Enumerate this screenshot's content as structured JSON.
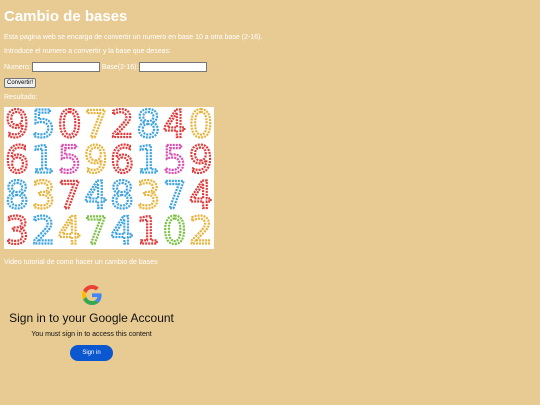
{
  "page": {
    "title": "Cambio de bases",
    "description": "Esta pagina web se encarga de convertir un numero en base 10 a otra base (2-16).",
    "instructions": "Introduce el numero a convertir y la base que deseas:",
    "result_label": "Resultado:",
    "video_caption": "Video tutorial de como hacer un cambio de bases"
  },
  "form": {
    "number_label": "Numero:",
    "number_value": "",
    "base_label": "Base(2-16):",
    "base_value": "",
    "convert_label": "Convertir!"
  },
  "image": {
    "glyphs": [
      {
        "t": "9",
        "c": "#e23a3a"
      },
      {
        "t": "5",
        "c": "#3fa3e0"
      },
      {
        "t": "0",
        "c": "#e23a3a"
      },
      {
        "t": "7",
        "c": "#e8b33b"
      },
      {
        "t": "2",
        "c": "#e23a3a"
      },
      {
        "t": "8",
        "c": "#3fa3e0"
      },
      {
        "t": "4",
        "c": "#e23a3a"
      },
      {
        "t": "0",
        "c": "#e8b33b"
      },
      {
        "t": "6",
        "c": "#e23a3a"
      },
      {
        "t": "1",
        "c": "#3fa3e0"
      },
      {
        "t": "5",
        "c": "#d94cb0"
      },
      {
        "t": "9",
        "c": "#e8b33b"
      },
      {
        "t": "6",
        "c": "#e23a3a"
      },
      {
        "t": "1",
        "c": "#3fa3e0"
      },
      {
        "t": "5",
        "c": "#d94cb0"
      },
      {
        "t": "9",
        "c": "#e23a3a"
      },
      {
        "t": "8",
        "c": "#3fa3e0"
      },
      {
        "t": "3",
        "c": "#e8b33b"
      },
      {
        "t": "7",
        "c": "#e23a3a"
      },
      {
        "t": "4",
        "c": "#3fa3e0"
      },
      {
        "t": "8",
        "c": "#3fa3e0"
      },
      {
        "t": "3",
        "c": "#e8b33b"
      },
      {
        "t": "7",
        "c": "#3fa3e0"
      },
      {
        "t": "4",
        "c": "#e23a3a"
      },
      {
        "t": "3",
        "c": "#e23a3a"
      },
      {
        "t": "2",
        "c": "#3fa3e0"
      },
      {
        "t": "4",
        "c": "#e8b33b"
      },
      {
        "t": "7",
        "c": "#7bc043"
      },
      {
        "t": "4",
        "c": "#3fa3e0"
      },
      {
        "t": "1",
        "c": "#e23a3a"
      },
      {
        "t": "0",
        "c": "#7bc043"
      },
      {
        "t": "2",
        "c": "#e8b33b"
      }
    ]
  },
  "signin": {
    "title": "Sign in to your Google Account",
    "subtitle": "You must sign in to access this content",
    "button_label": "Sign in"
  },
  "colors": {
    "page_background": "#e8cb93",
    "signin_button": "#0b57d0"
  }
}
